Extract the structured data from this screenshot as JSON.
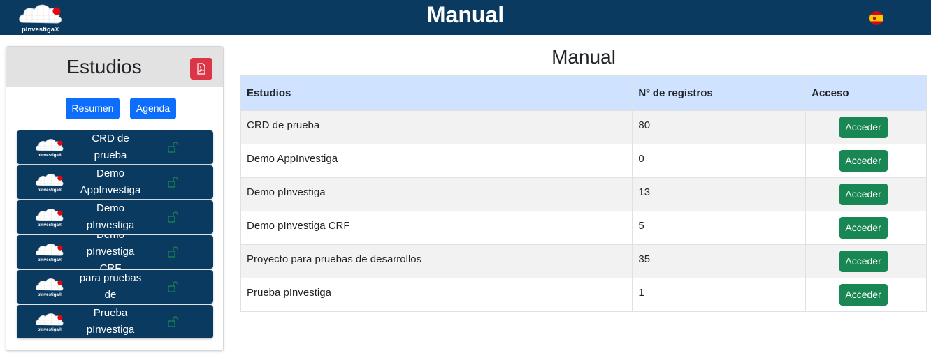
{
  "header": {
    "title": "Manual",
    "logo_text": "pInvestiga®",
    "language_flag": "spain-flag-icon"
  },
  "sidebar": {
    "title": "Estudios",
    "pdf_icon": "file-pdf-icon",
    "buttons": {
      "resumen": "Resumen",
      "agenda": "Agenda"
    },
    "items": [
      {
        "lines": [
          "CRD de",
          "prueba"
        ]
      },
      {
        "lines": [
          "Demo",
          "AppInvestiga"
        ]
      },
      {
        "lines": [
          "Demo",
          "pInvestiga"
        ]
      },
      {
        "lines": [
          "Demo",
          "pInvestiga",
          "CRF"
        ]
      },
      {
        "lines": [
          "para pruebas",
          "de"
        ]
      },
      {
        "lines": [
          "Prueba",
          "pInvestiga"
        ]
      }
    ],
    "lock_icon": "unlock-icon"
  },
  "main": {
    "title": "Manual",
    "columns": [
      "Estudios",
      "Nº de registros",
      "Acceso"
    ],
    "access_label": "Acceder",
    "rows": [
      {
        "estudio": "CRD de prueba",
        "registros": "80"
      },
      {
        "estudio": "Demo AppInvestiga",
        "registros": "0"
      },
      {
        "estudio": "Demo pInvestiga",
        "registros": "13"
      },
      {
        "estudio": "Demo pInvestiga CRF",
        "registros": "5"
      },
      {
        "estudio": "Proyecto para pruebas de desarrollos",
        "registros": "35"
      },
      {
        "estudio": "Prueba pInvestiga",
        "registros": "1"
      }
    ]
  },
  "colors": {
    "navbar": "#0b3a60",
    "primary": "#0d6efd",
    "success": "#198754",
    "danger": "#dc3545",
    "table_head": "#cfe2ff"
  }
}
